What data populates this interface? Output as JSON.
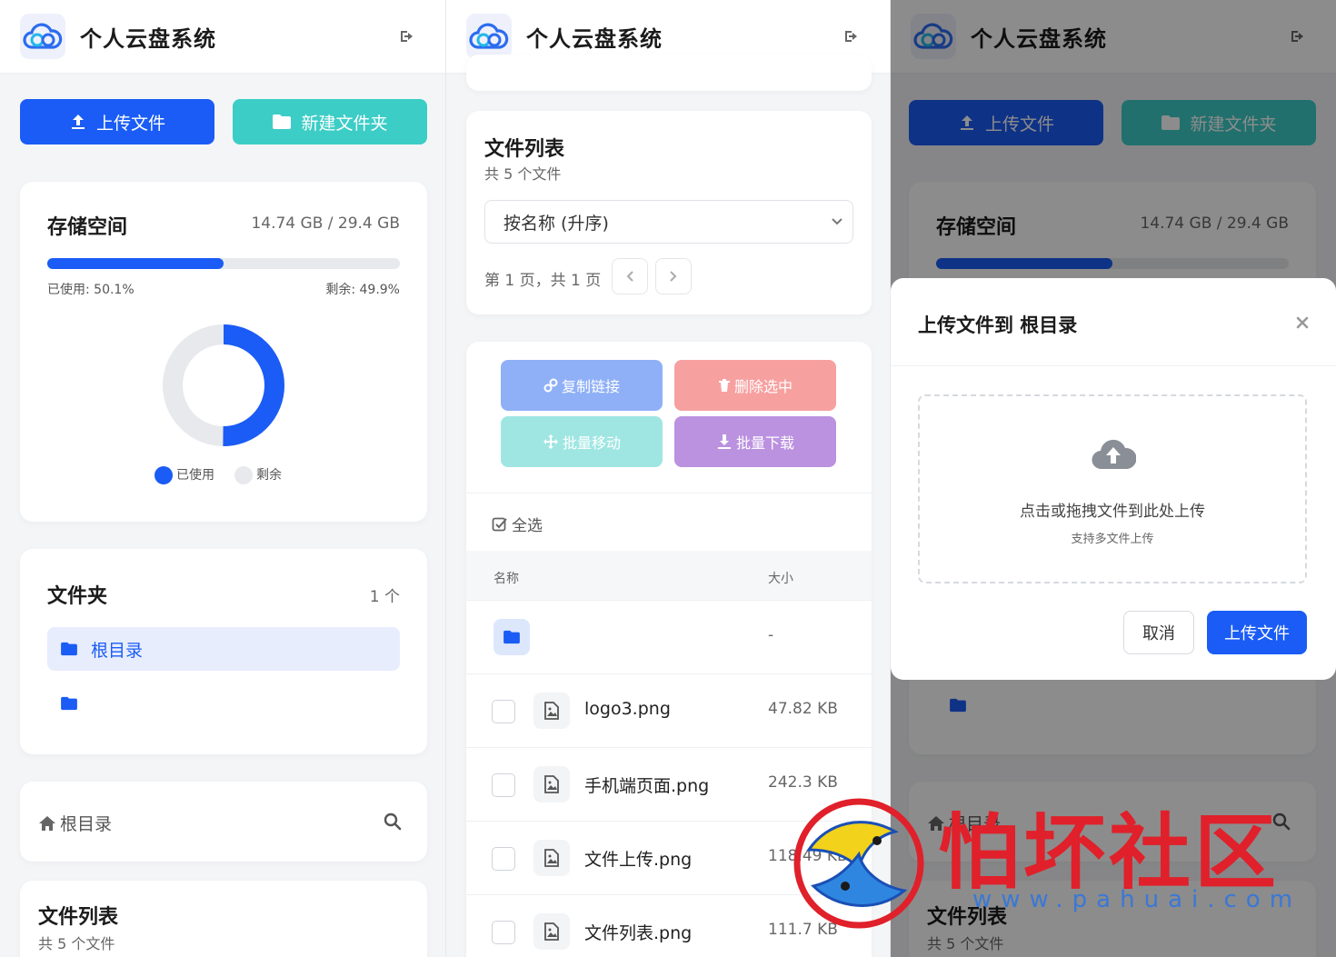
{
  "app": {
    "title": "个人云盘系统"
  },
  "toolbar": {
    "upload_label": "上传文件",
    "new_folder_label": "新建文件夹"
  },
  "storage": {
    "title": "存储空间",
    "usage_text": "14.74 GB / 29.4 GB",
    "used_text": "已使用: 50.1%",
    "remaining_text": "剩余: 49.9%",
    "used_fraction": 0.501,
    "legend_used": "已使用",
    "legend_remaining": "剩余",
    "color_used": "#1a5cf5",
    "color_remaining": "#e8e9ed"
  },
  "folders": {
    "title": "文件夹",
    "count": "1 个",
    "root_label": "根目录"
  },
  "breadcrumb": {
    "label": "根目录"
  },
  "file_list": {
    "title": "文件列表",
    "count": "共 5 个文件",
    "sort_value": "按名称 (升序)",
    "page_info": "第 1 页，共 1 页",
    "select_all": "全选",
    "col_name": "名称",
    "col_size": "大小",
    "folder_size": "-",
    "files": [
      {
        "name": "logo3.png",
        "size": "47.82 KB"
      },
      {
        "name": "手机端页面.png",
        "size": "242.3 KB"
      },
      {
        "name": "文件上传.png",
        "size": "118.49 KB"
      },
      {
        "name": "文件列表.png",
        "size": "111.7 KB"
      }
    ]
  },
  "actions": {
    "copy_link": "复制链接",
    "delete_selected": "删除选中",
    "batch_move": "批量移动",
    "batch_download": "批量下载",
    "color_copy": "#8fb0f7",
    "color_delete": "#f7a0a0",
    "color_move": "#9fe6e2",
    "color_download": "#bb92e0"
  },
  "modal": {
    "title": "上传文件到 根目录",
    "drop_text": "点击或拖拽文件到此处上传",
    "drop_sub": "支持多文件上传",
    "cancel_label": "取消",
    "confirm_label": "上传文件"
  },
  "watermark": {
    "text": "怕坏社区",
    "url": "www.pahuai.com"
  }
}
